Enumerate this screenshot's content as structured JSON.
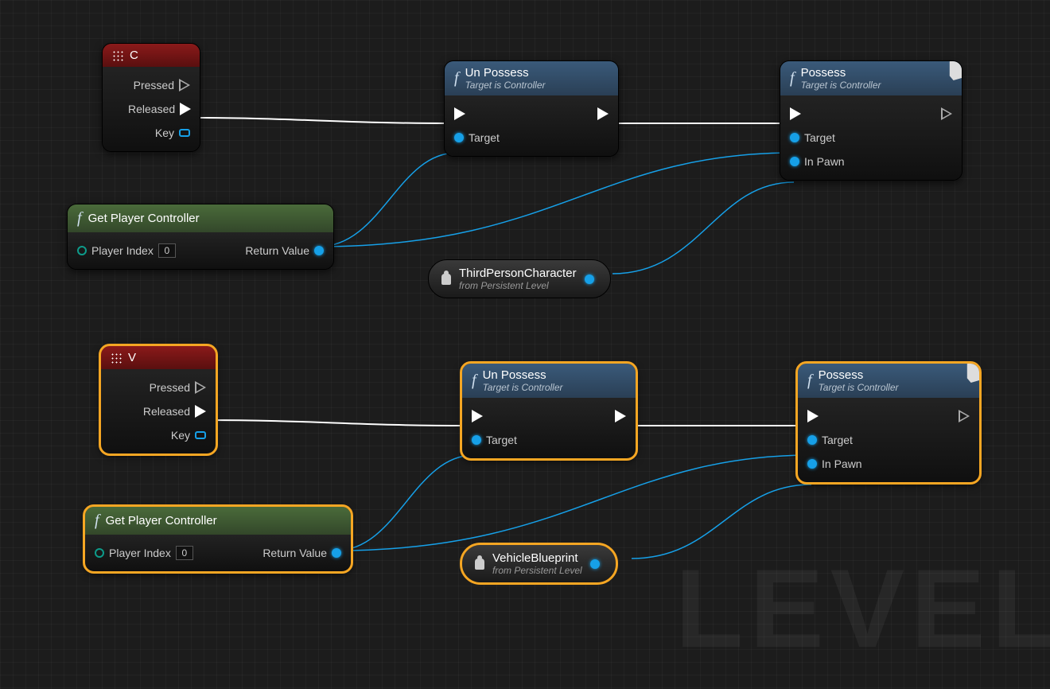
{
  "watermark": "LEVEL",
  "nodes": {
    "eventC": {
      "title": "C",
      "pinPressed": "Pressed",
      "pinReleased": "Released",
      "pinKey": "Key"
    },
    "eventV": {
      "title": "V",
      "pinPressed": "Pressed",
      "pinReleased": "Released",
      "pinKey": "Key"
    },
    "unpossess1": {
      "title": "Un Possess",
      "subtitle": "Target is Controller",
      "pinTarget": "Target"
    },
    "unpossess2": {
      "title": "Un Possess",
      "subtitle": "Target is Controller",
      "pinTarget": "Target"
    },
    "possess1": {
      "title": "Possess",
      "subtitle": "Target is Controller",
      "pinTarget": "Target",
      "pinInPawn": "In Pawn"
    },
    "possess2": {
      "title": "Possess",
      "subtitle": "Target is Controller",
      "pinTarget": "Target",
      "pinInPawn": "In Pawn"
    },
    "getPC1": {
      "title": "Get Player Controller",
      "pinPlayerIndex": "Player Index",
      "pinPlayerIndexValue": "0",
      "pinReturn": "Return Value"
    },
    "getPC2": {
      "title": "Get Player Controller",
      "pinPlayerIndex": "Player Index",
      "pinPlayerIndexValue": "0",
      "pinReturn": "Return Value"
    },
    "ref1": {
      "title": "ThirdPersonCharacter",
      "subtitle": "from Persistent Level"
    },
    "ref2": {
      "title": "VehicleBlueprint",
      "subtitle": "from Persistent Level"
    }
  }
}
